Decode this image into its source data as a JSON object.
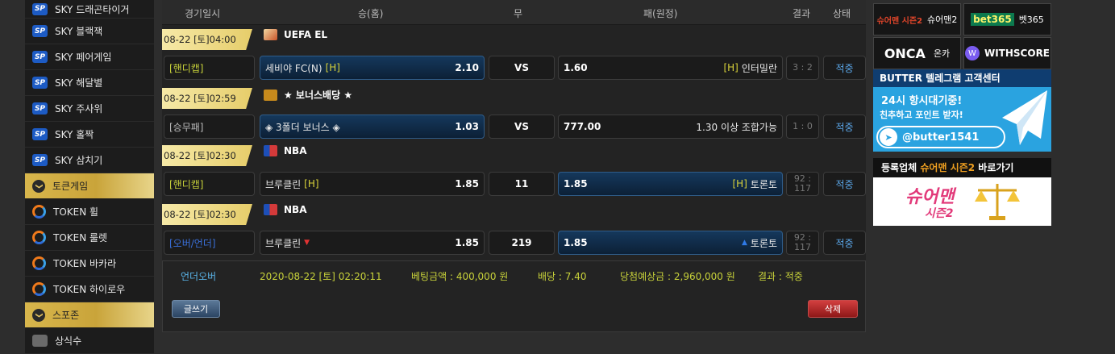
{
  "sidebar": {
    "items": [
      {
        "type": "sp",
        "label": "SKY 드래곤타이거"
      },
      {
        "type": "sp",
        "label": "SKY 블랙잭"
      },
      {
        "type": "sp",
        "label": "SKY 페어게임"
      },
      {
        "type": "sp",
        "label": "SKY 해달별"
      },
      {
        "type": "sp",
        "label": "SKY 주사위"
      },
      {
        "type": "sp",
        "label": "SKY 홀짝"
      },
      {
        "type": "sp",
        "label": "SKY 삼치기"
      },
      {
        "type": "header",
        "label": "토큰게임"
      },
      {
        "type": "token",
        "label": "TOKEN 휠"
      },
      {
        "type": "token",
        "label": "TOKEN 룰렛"
      },
      {
        "type": "token",
        "label": "TOKEN 바카라"
      },
      {
        "type": "token",
        "label": "TOKEN 하이로우"
      },
      {
        "type": "header",
        "label": "스포존"
      },
      {
        "type": "other",
        "label": "상식수"
      }
    ],
    "sp_badge": "SP",
    "chevron_glyph": "❯"
  },
  "table": {
    "headers": {
      "date": "경기일시",
      "home": "승(홈)",
      "draw": "무",
      "away": "패(원정)",
      "result": "결과",
      "status": "상태"
    },
    "games": [
      {
        "date": "08-22 [토]04:00",
        "league": "UEFA EL",
        "flag": "uefa-flag-icon",
        "type": "[핸디캡]",
        "type_color": "#c8d23a",
        "home": "세비야 FC(N)",
        "home_tag": "[H]",
        "home_odds": "2.10",
        "home_selected": true,
        "draw": "VS",
        "away_odds": "1.60",
        "away_tag": "[H]",
        "away": "인터밀란",
        "away_selected": false,
        "result": "3 : 2",
        "status": "적중"
      },
      {
        "date": "08-22 [토]02:59",
        "league": "★ 보너스배당 ★",
        "flag": "bonus-flag-icon",
        "type": "[승무패]",
        "type_color": "#bbbbbb",
        "home": "◈ 3폴더 보너스 ◈",
        "home_tag": "",
        "home_odds": "1.03",
        "home_selected": true,
        "draw": "VS",
        "away_odds": "777.00",
        "away_tag": "",
        "away": "1.30 이상 조합가능",
        "away_selected": false,
        "result": "1 : 0",
        "status": "적중"
      },
      {
        "date": "08-22 [토]02:30",
        "league": "NBA",
        "flag": "nba-flag-icon",
        "type": "[핸디캡]",
        "type_color": "#c8d23a",
        "home": "브루클린",
        "home_tag": "[H]",
        "home_odds": "1.85",
        "home_selected": false,
        "draw": "11",
        "away_odds": "1.85",
        "away_tag": "[H]",
        "away": "토론토",
        "away_selected": true,
        "result": "92 : 117",
        "status": "적중"
      },
      {
        "date": "08-22 [토]02:30",
        "league": "NBA",
        "flag": "nba-flag-icon",
        "type": "[오버/언더]",
        "type_color": "#3a6fd8",
        "home": "브루클린",
        "home_tag": "▼",
        "home_odds": "1.85",
        "home_selected": false,
        "draw": "219",
        "away_odds": "1.85",
        "away_tag": "▲",
        "away": "토론토",
        "away_selected": true,
        "result": "92 : 117",
        "status": "적중"
      }
    ]
  },
  "summary": {
    "game_type": "언더오버",
    "datetime": "2020-08-22 [토] 02:20:11",
    "bet_amount": "베팅금액 : 400,000 원",
    "odds": "배당 : 7.40",
    "expected": "당첨예상금 : 2,960,000 원",
    "result": "결과 : 적중",
    "write_button": "글쓰기",
    "delete_button": "삭제"
  },
  "partners": [
    {
      "logo": "슈어맨 시즌2",
      "label": "슈어맨2"
    },
    {
      "logo": "bet365",
      "label": "벳365"
    },
    {
      "logo": "ONCA",
      "label": "온카"
    },
    {
      "logo": "W",
      "label": "WITHSCORE"
    }
  ],
  "telegram_banner": {
    "title": "BUTTER 텔레그램 고객센터",
    "line1": "24시 항시대기중!",
    "line2": "친추하고 포인트 받자!",
    "handle": "@butter1541"
  },
  "sureman_banner": {
    "title_prefix": "등록업체",
    "title_highlight": "슈어맨 시즌2",
    "title_suffix": "바로가기",
    "logo_top": "슈어맨",
    "logo_bottom": "시즌2"
  },
  "colors": {
    "accent_gold": "#e6cd6a",
    "status_blue": "#5aa6e8",
    "handicap_yellow": "#c8d23a",
    "telegram_blue": "#2aa3e0",
    "delete_red": "#b22a2a"
  }
}
